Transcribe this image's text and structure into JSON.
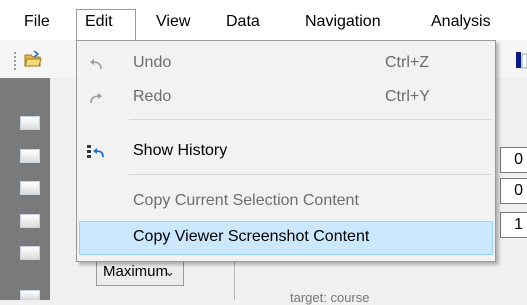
{
  "menubar": {
    "items": [
      "File",
      "Edit",
      "View",
      "Data",
      "Navigation",
      "Analysis"
    ]
  },
  "edit_menu": {
    "items": [
      {
        "label": "Undo",
        "shortcut": "Ctrl+Z",
        "enabled": false
      },
      {
        "label": "Redo",
        "shortcut": "Ctrl+Y",
        "enabled": false
      },
      {
        "label": "Show History",
        "shortcut": "",
        "enabled": true
      },
      {
        "label": "Copy Current Selection Content",
        "shortcut": "",
        "enabled": false
      },
      {
        "label": "Copy Viewer Screenshot Content",
        "shortcut": "",
        "enabled": true,
        "highlighted": true
      }
    ]
  },
  "panel": {
    "values": [
      "0",
      "0",
      "1"
    ],
    "select_value": "Maximum",
    "partial_text": "target: course"
  },
  "colors": {
    "highlight_bg": "#cce8ff",
    "highlight_border": "#99d1ff",
    "left_column": "#7a7a7a"
  }
}
